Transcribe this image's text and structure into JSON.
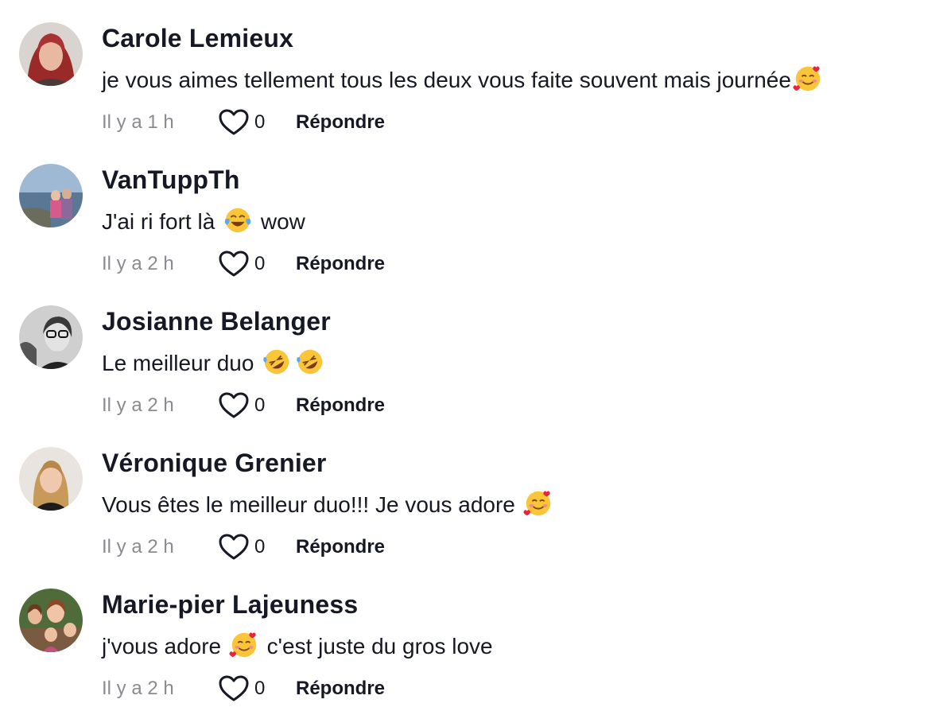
{
  "comments": [
    {
      "author": "Carole Lemieux",
      "text_before": "je vous aimes tellement tous les deux vous faite souvent mais journée",
      "emojis": [
        "smiling-face-with-hearts"
      ],
      "text_after": "",
      "time": "Il y a 1 h",
      "likes": "0",
      "reply_label": "Répondre",
      "avatar_icon": "avatar-red-hair"
    },
    {
      "author": "VanTuppTh",
      "text_before": "J'ai ri fort là",
      "emojis": [
        "face-with-tears-of-joy"
      ],
      "text_after": "wow",
      "time": "Il y a 2 h",
      "likes": "0",
      "reply_label": "Répondre",
      "avatar_icon": "avatar-lake-photo"
    },
    {
      "author": "Josianne Belanger",
      "text_before": "Le meilleur duo",
      "emojis": [
        "rolling-on-floor-laughing",
        "rolling-on-floor-laughing"
      ],
      "text_after": "",
      "time": "Il y a 2 h",
      "likes": "0",
      "reply_label": "Répondre",
      "avatar_icon": "avatar-glasses-bw"
    },
    {
      "author": "Véronique Grenier",
      "text_before": "Vous êtes le meilleur duo!!! Je vous adore",
      "emojis": [
        "smiling-face-with-hearts"
      ],
      "text_after": "",
      "time": "Il y a 2 h",
      "likes": "0",
      "reply_label": "Répondre",
      "avatar_icon": "avatar-blonde"
    },
    {
      "author": "Marie-pier Lajeuness",
      "text_before": "j'vous adore",
      "emojis": [
        "smiling-face-with-hearts"
      ],
      "text_after": "c'est juste du gros love",
      "time": "Il y a 2 h",
      "likes": "0",
      "reply_label": "Répondre",
      "avatar_icon": "avatar-family-photo"
    }
  ],
  "colors": {
    "text": "#161823",
    "muted": "#8a8b91",
    "background": "#ffffff"
  }
}
